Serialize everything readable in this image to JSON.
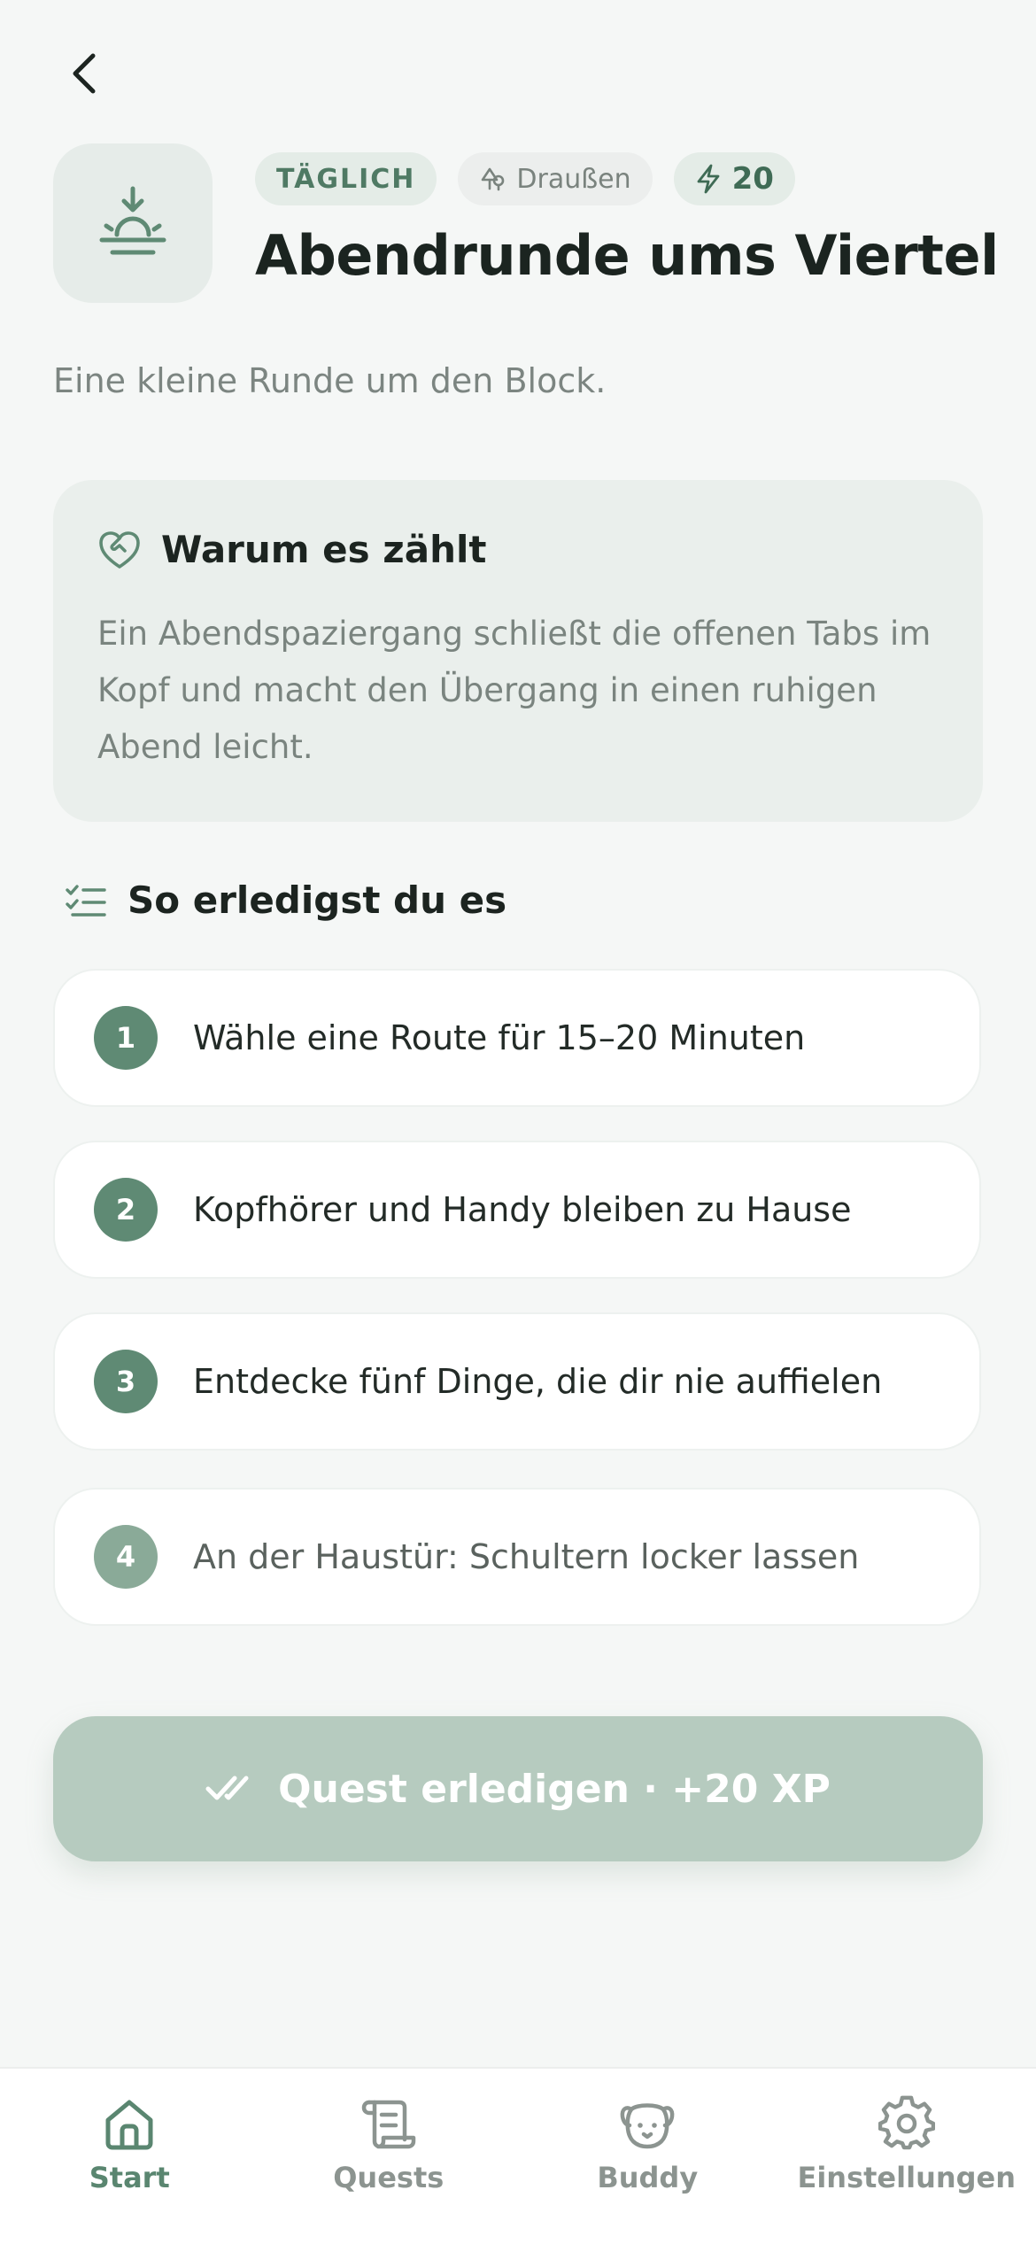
{
  "header": {
    "frequency_badge": "TÄGLICH",
    "location_badge": "Draußen",
    "xp_badge": "20",
    "title": "Abendrunde ums Viertel",
    "subtitle": "Eine kleine Runde um den Block."
  },
  "why": {
    "title": "Warum es zählt",
    "body": "Ein Abendspaziergang schließt die offenen Tabs im Kopf und macht den Übergang in einen ruhigen Abend leicht."
  },
  "howto": {
    "title": "So erledigst du es",
    "steps": [
      {
        "num": "1",
        "text": "Wähle eine Route für 15–20 Minuten"
      },
      {
        "num": "2",
        "text": "Kopfhörer und Handy bleiben zu Hause"
      },
      {
        "num": "3",
        "text": "Entdecke fünf Dinge, die dir nie auffielen"
      },
      {
        "num": "4",
        "text": "An der Haustür: Schultern locker lassen"
      }
    ]
  },
  "cta": {
    "label": "Quest erledigen · +20 XP"
  },
  "tabbar": {
    "items": [
      {
        "label": "Start",
        "icon": "home-icon",
        "active": true
      },
      {
        "label": "Quests",
        "icon": "scroll-icon",
        "active": false
      },
      {
        "label": "Buddy",
        "icon": "dog-face-icon",
        "active": false
      },
      {
        "label": "Einstellungen",
        "icon": "gear-icon",
        "active": false
      }
    ]
  },
  "colors": {
    "accent": "#5a8670",
    "background": "#f5f7f6",
    "cta_disabled": "#b6cbbf"
  }
}
